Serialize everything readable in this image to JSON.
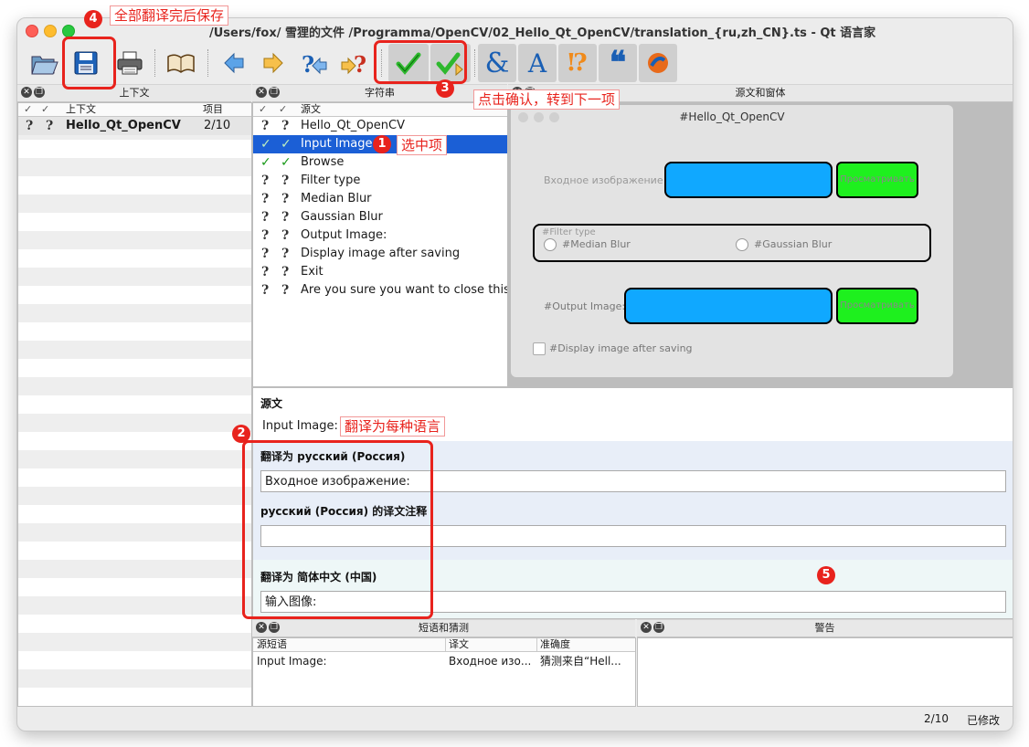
{
  "window": {
    "title": "/Users/fox/ 雪狸的文件 /Programma/OpenCV/02_Hello_Qt_OpenCV/translation_{ru,zh_CN}.ts - Qt 语言家"
  },
  "toolbar": {
    "icons": [
      "open-icon",
      "save-icon",
      "print-icon",
      "phrasebook-icon",
      "prev-icon",
      "next-icon",
      "prev-unfinished-icon",
      "next-unfinished-icon",
      "done-prev-icon",
      "done-next-icon",
      "accelerator-icon",
      "ending-punctuation-icon",
      "phrase-match-icon",
      "place-marker-icon",
      "validation-icon"
    ]
  },
  "context_pane": {
    "title": "上下文",
    "col_context": "上下文",
    "col_items": "项目",
    "rows": [
      {
        "name": "Hello_Qt_OpenCV",
        "count": "2/10"
      }
    ]
  },
  "strings_pane": {
    "title": "字符串",
    "col_source": "源文",
    "rows": [
      {
        "text": "Hello_Qt_OpenCV",
        "status": "unfinished"
      },
      {
        "text": "Input Image:",
        "status": "done",
        "selected": true
      },
      {
        "text": "Browse",
        "status": "done"
      },
      {
        "text": "Filter type",
        "status": "unfinished"
      },
      {
        "text": "Median Blur",
        "status": "unfinished"
      },
      {
        "text": "Gaussian Blur",
        "status": "unfinished"
      },
      {
        "text": "Output Image:",
        "status": "unfinished"
      },
      {
        "text": "Display image after saving",
        "status": "unfinished"
      },
      {
        "text": "Exit",
        "status": "unfinished"
      },
      {
        "text": "Are you sure you want to close this...",
        "status": "unfinished"
      }
    ]
  },
  "preview_pane": {
    "title": "源文和窗体",
    "form_title": "#Hello_Qt_OpenCV",
    "input_label": "Входное изображение",
    "browse_label": "Просматривать",
    "filter_group": "#Filter type",
    "radio_median": "#Median Blur",
    "radio_gaussian": "#Gaussian Blur",
    "output_label": "#Output Image:",
    "browse_label2": "Просматривать",
    "checkbox_label": "#Display image after saving"
  },
  "editor": {
    "source_heading": "源文",
    "source_text": "Input Image:",
    "ru_heading": "翻译为 русский (Россия)",
    "ru_value": "Входное изображение:",
    "ru_comment_heading": "русский (Россия) 的译文注释",
    "ru_comment_value": "",
    "zh_heading": "翻译为 简体中文 (中国)",
    "zh_value": "输入图像:"
  },
  "phrases_pane": {
    "title": "短语和猜测",
    "col_source": "源短语",
    "col_translation": "译文",
    "col_accuracy": "准确度",
    "rows": [
      {
        "source": "Input Image:",
        "translation": "Входное изо...",
        "accuracy": "猜测来自“Hell..."
      }
    ]
  },
  "warnings_pane": {
    "title": "警告"
  },
  "statusbar": {
    "progress": "2/10",
    "state": "已修改"
  },
  "annotations": {
    "n1": "1",
    "t1": "选中项",
    "n2": "2",
    "t2": "翻译为每种语言",
    "n3": "3",
    "t3": "点击确认，转到下一项",
    "n4": "4",
    "t4": "全部翻译完后保存",
    "n5": "5"
  },
  "colors": {
    "accent_red": "#e8231d",
    "selection_blue": "#1b5fd6",
    "done_green": "#1a9a1a",
    "preview_blue": "#10a8ff",
    "preview_green": "#1ef01e"
  }
}
